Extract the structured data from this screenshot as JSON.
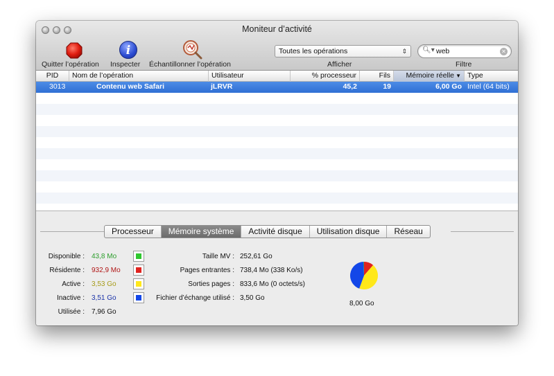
{
  "window": {
    "title": "Moniteur d’activité"
  },
  "toolbar": {
    "quit_label": "Quitter l’opération",
    "inspect_label": "Inspecter",
    "sample_label": "Échantillonner l’opération",
    "show_label": "Afficher",
    "filter_label": "Filtre",
    "show_select_value": "Toutes les opérations",
    "search_value": "web"
  },
  "table": {
    "columns": [
      "PID",
      "Nom de l’opération",
      "Utilisateur",
      "% processeur",
      "Fils",
      "Mémoire réelle",
      "Type"
    ],
    "sorted_column": "Mémoire réelle",
    "rows": [
      {
        "pid": "3013",
        "name": "Contenu web Safari",
        "user": "jLRVR",
        "cpu": "45,2",
        "threads": "19",
        "memory": "6,00 Go",
        "type": "Intel (64 bits)"
      }
    ]
  },
  "tabs": [
    "Processeur",
    "Mémoire système",
    "Activité disque",
    "Utilisation disque",
    "Réseau"
  ],
  "active_tab": "Mémoire système",
  "memory": {
    "free_label": "Disponible :",
    "free_value": "43,8 Mo",
    "wired_label": "Résidente :",
    "wired_value": "932,9 Mo",
    "active_label": "Active :",
    "active_value": "3,53 Go",
    "inactive_label": "Inactive :",
    "inactive_value": "3,51 Go",
    "used_label": "Utilisée :",
    "used_value": "7,96 Go",
    "vm_label": "Taille MV :",
    "vm_value": "252,61 Go",
    "pagein_label": "Pages entrantes :",
    "pagein_value": "738,4 Mo (338 Ko/s)",
    "pageout_label": "Sorties pages :",
    "pageout_value": "833,6 Mo (0 octets/s)",
    "swap_label": "Fichier d’échange utilisé :",
    "swap_value": "3,50 Go",
    "total_value": "8,00 Go"
  },
  "colors": {
    "free": "#2fc82f",
    "wired": "#e0231f",
    "active": "#ffe81a",
    "inactive": "#1347e8",
    "free_text": "#2b9e2b",
    "wired_text": "#b01414",
    "active_text": "#a69a17",
    "inactive_text": "#1a32a8"
  }
}
